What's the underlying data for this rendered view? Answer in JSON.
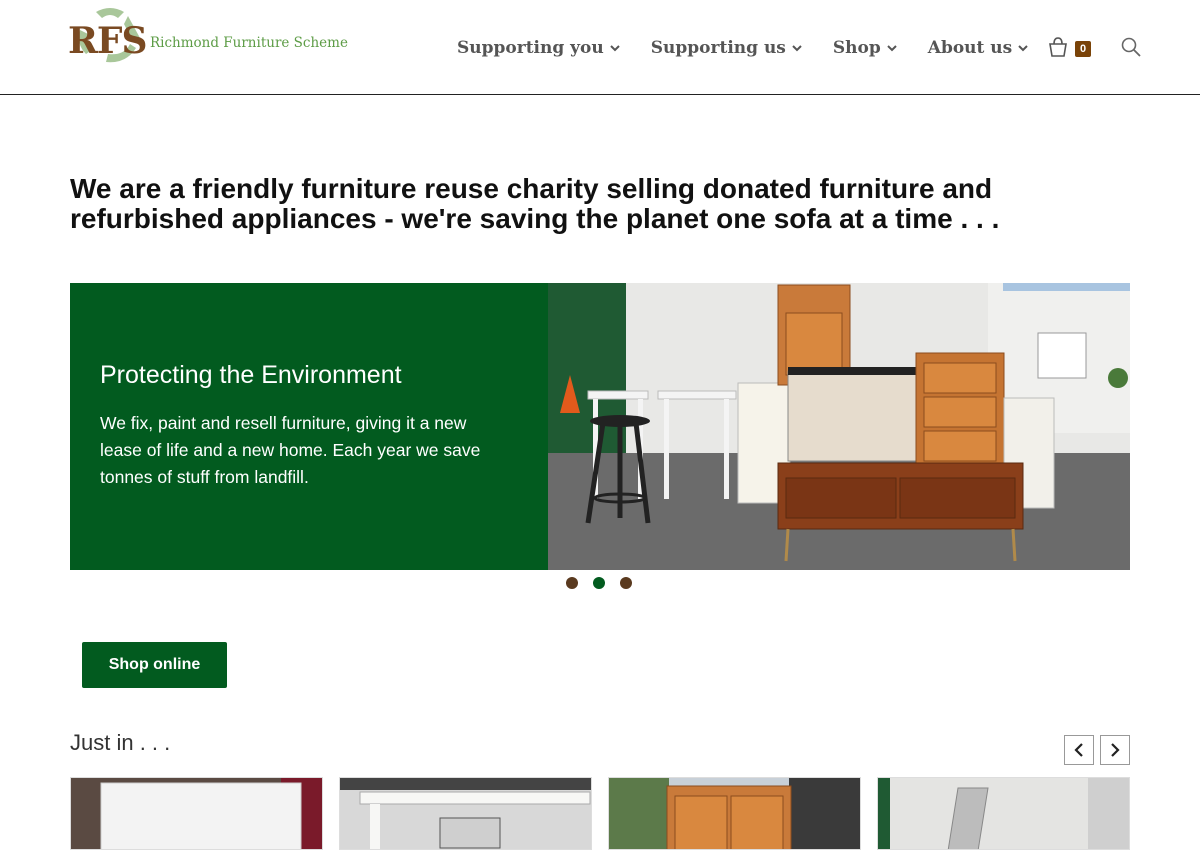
{
  "header": {
    "logo_mark": "RFS",
    "logo_text": "Richmond Furniture Scheme",
    "nav": [
      {
        "label": "Supporting you"
      },
      {
        "label": "Supporting us"
      },
      {
        "label": "Shop"
      },
      {
        "label": "About us"
      }
    ],
    "cart_count": "0"
  },
  "tagline": "We are a friendly furniture reuse charity selling donated furniture and refurbished appliances - we're saving the planet one sofa at a time . . .",
  "slider": {
    "title": "Protecting the Environment",
    "text": "We fix, paint and resell furniture, giving it a new lease of life and a new home.  Each year we save tonnes of stuff from landfill.",
    "active_dot": 2,
    "dot_count": 3
  },
  "cta": {
    "shop_label": "Shop online"
  },
  "just_in": {
    "heading": "Just in . . ."
  },
  "colors": {
    "brand_green": "#025b1f",
    "brand_brown": "#7a4a22",
    "logo_green": "#5d9c46",
    "badge_brown": "#7a4308"
  }
}
